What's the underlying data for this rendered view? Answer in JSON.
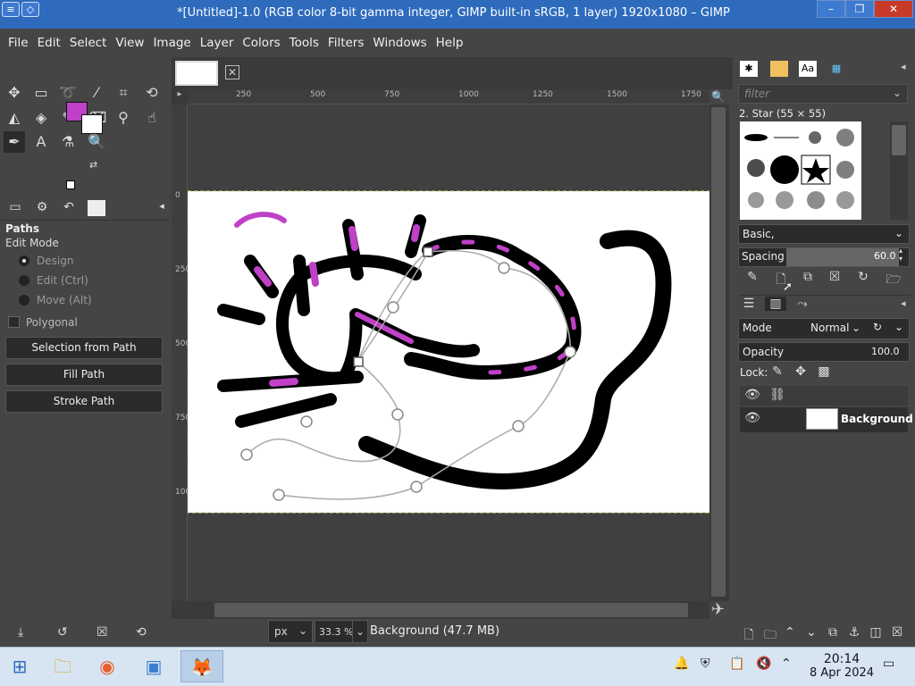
{
  "window": {
    "title": "*[Untitled]-1.0 (RGB color 8-bit gamma integer, GIMP built-in sRGB, 1 layer) 1920x1080 – GIMP",
    "min_label": "–",
    "max_label": "❐",
    "close_label": "✕"
  },
  "menu": [
    "File",
    "Edit",
    "Select",
    "View",
    "Image",
    "Layer",
    "Colors",
    "Tools",
    "Filters",
    "Windows",
    "Help"
  ],
  "colors": {
    "foreground": "#c040c8",
    "background": "#ffffff",
    "accent": "#2e6bbd"
  },
  "tool_options": {
    "title": "Paths",
    "edit_mode_label": "Edit Mode",
    "modes": [
      {
        "label": "Design",
        "selected": true
      },
      {
        "label": "Edit (Ctrl)",
        "selected": false
      },
      {
        "label": "Move (Alt)",
        "selected": false
      }
    ],
    "polygonal_label": "Polygonal",
    "buttons": [
      "Selection from Path",
      "Fill Path",
      "Stroke Path"
    ]
  },
  "rulers": {
    "h_ticks": [
      "250",
      "500",
      "750",
      "1000",
      "1250",
      "1500",
      "1750"
    ],
    "v_ticks": [
      "0",
      "250",
      "500",
      "750",
      "1000"
    ]
  },
  "statusbar": {
    "unit": "px",
    "zoom": "33.3 %",
    "message": "Background (47.7 MB)"
  },
  "brushes": {
    "filter_placeholder": "filter",
    "selected": "2. Star (55 × 55)",
    "tag": "Basic,",
    "spacing_label": "Spacing",
    "spacing_value": "60.0",
    "spacing_fraction": 0.6
  },
  "layers": {
    "mode_label": "Mode",
    "mode_value": "Normal",
    "opacity_label": "Opacity",
    "opacity_value": "100.0",
    "lock_label": "Lock:",
    "items": [
      {
        "name": "Background",
        "visible": true
      }
    ]
  },
  "taskbar": {
    "time": "20:14",
    "date": "8 Apr 2024"
  }
}
